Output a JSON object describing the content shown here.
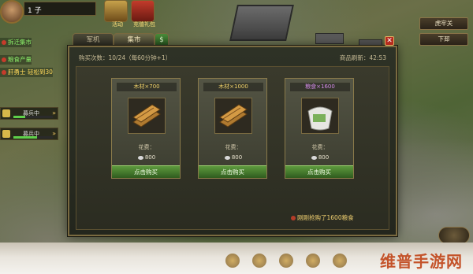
{
  "hud": {
    "level": "1 子",
    "icons": [
      {
        "name": "activity",
        "label": "活动"
      },
      {
        "name": "gift",
        "label": "充值礼包"
      }
    ],
    "side_lines": [
      {
        "text": "拆迁集市",
        "color": "green"
      },
      {
        "text": "粮食产量",
        "color": "green"
      },
      {
        "text": "肝勇士   轻松到30",
        "color": "yellow"
      }
    ],
    "troops": [
      {
        "label": "募兵中",
        "progress": 0.3
      },
      {
        "label": "募兵中",
        "progress": 0.6
      }
    ]
  },
  "right_buttons": [
    "虎牢关",
    "下邳"
  ],
  "dialog": {
    "tabs": [
      "军机",
      "集市",
      "$"
    ],
    "active_tab": 1,
    "close_label": "✕",
    "buy_count_text": "购买次数：10/24（每60分钟+1）",
    "refresh_text": "商品刷新：42:53",
    "cards": [
      {
        "name": "木材×700",
        "kind": "wood",
        "price_label": "花费：",
        "price": "800",
        "buy_label": "点击购买"
      },
      {
        "name": "木材×1000",
        "kind": "wood",
        "price_label": "花费：",
        "price": "800",
        "buy_label": "点击购买"
      },
      {
        "name": "粮食×1600",
        "kind": "food",
        "price_label": "花费：",
        "price": "800",
        "buy_label": "点击购买"
      }
    ],
    "notice": "刚刚抢购了1600粮食"
  },
  "watermark": "维普手游网"
}
